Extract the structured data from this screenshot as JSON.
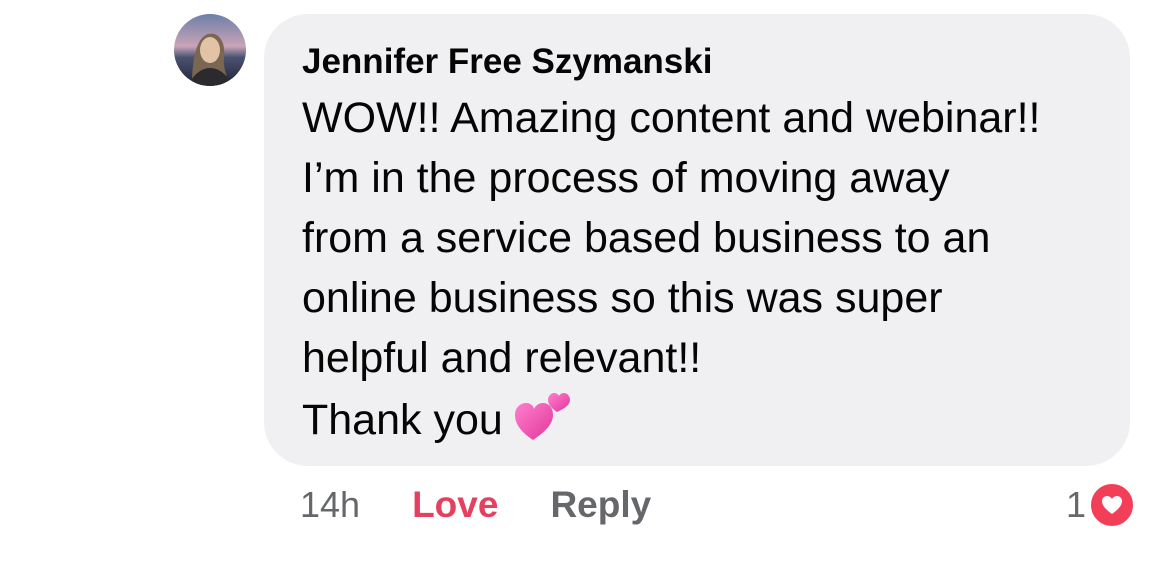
{
  "comment": {
    "author": "Jennifer Free Szymanski",
    "lines": [
      "WOW!! Amazing content and webinar!!",
      "I’m in the process of moving away",
      "from a service based business to an",
      "online business so this was super",
      "helpful and relevant!!",
      "Thank you"
    ],
    "emoji": "two-hearts-icon",
    "timestamp": "14h",
    "love_label": "Love",
    "reply_label": "Reply",
    "reaction_count": "1",
    "reaction_icon": "heart-icon"
  },
  "colors": {
    "bubble": "#f0f0f2",
    "love_active": "#e4405f",
    "secondary_text": "#65676b",
    "heart_badge": "#f33e58"
  }
}
